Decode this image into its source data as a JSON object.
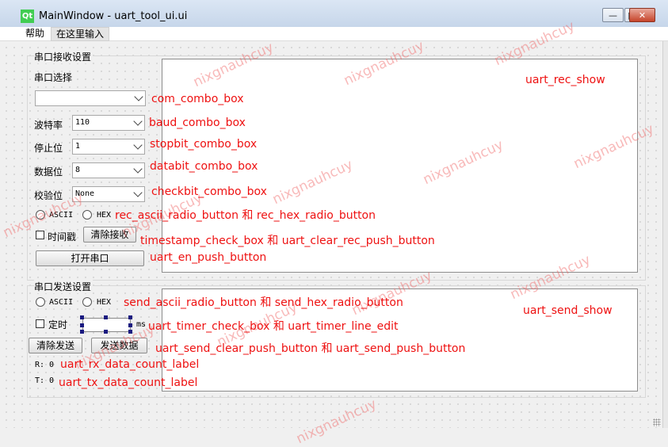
{
  "window": {
    "title": "MainWindow - uart_tool_ui.ui",
    "logo_text": "Qt",
    "controls": {
      "minimize": "—",
      "maximize": "□",
      "close": "✕"
    }
  },
  "menubar": {
    "items": [
      "帮助",
      "在这里输入"
    ]
  },
  "receive": {
    "group_title": "串口接收设置",
    "port_label": "串口选择",
    "baud_label": "波特率",
    "baud_value": "110",
    "stopbit_label": "停止位",
    "stopbit_value": "1",
    "databit_label": "数据位",
    "databit_value": "8",
    "checkbit_label": "校验位",
    "checkbit_value": "None",
    "ascii_label": "ASCII",
    "hex_label": "HEX",
    "timestamp_label": "时间戳",
    "clear_label": "清除接收",
    "open_label": "打开串口"
  },
  "send": {
    "group_title": "串口发送设置",
    "ascii_label": "ASCII",
    "hex_label": "HEX",
    "timer_label": "定时",
    "ms_label": "ms",
    "clear_label": "清除发送",
    "send_label": "发送数据",
    "rx_label": "R: 0",
    "tx_label": "T: 0"
  },
  "annotations": {
    "rec_show": "uart_rec_show",
    "com_combo": "com_combo_box",
    "baud_combo": "baud_combo_box",
    "stopbit_combo": "stopbit_combo_box",
    "databit_combo": "databit_combo_box",
    "checkbit_combo": "checkbit_combo_box",
    "rec_radio": "rec_ascii_radio_button 和 rec_hex_radio_button",
    "timestamp": "timestamp_check_box 和 uart_clear_rec_push_button",
    "en_button": "uart_en_push_button",
    "send_radio": "send_ascii_radio_button 和 send_hex_radio_button",
    "send_show": "uart_send_show",
    "timer": "uart_timer_check_box 和 uart_timer_line_edit",
    "send_buttons": "uart_send_clear_push_button 和 uart_send_push_button",
    "rx_count": "uart_rx_data_count_label",
    "tx_count": "uart_tx_data_count_label"
  },
  "watermark": "nixgnauhcuy",
  "colors": {
    "annotation": "#ee1111",
    "watermark": "#f06464",
    "qt_logo": "#41cd52"
  }
}
